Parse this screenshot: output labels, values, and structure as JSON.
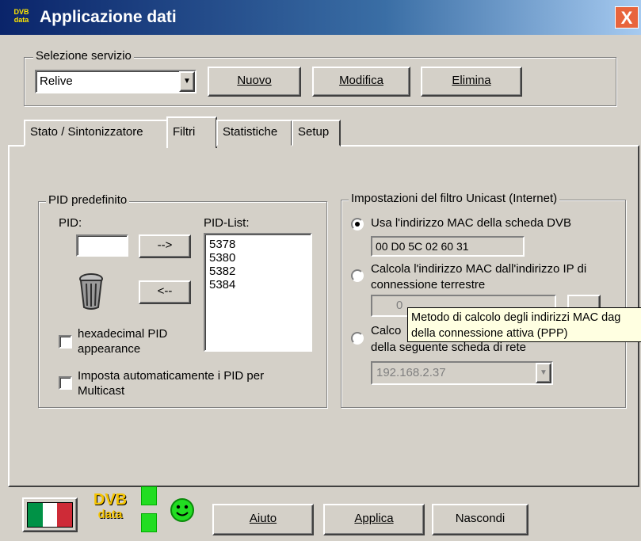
{
  "window": {
    "title": "Applicazione dati",
    "app_icon_text": "DVB data",
    "close_glyph": "X"
  },
  "service": {
    "group_label": "Selezione servizio",
    "selected": "Relive",
    "new_label": "Nuovo",
    "edit_label": "Modifica",
    "delete_label": "Elimina"
  },
  "tabs": [
    {
      "label": "Stato / Sintonizzatore",
      "active": false
    },
    {
      "label": "Filtri",
      "active": true
    },
    {
      "label": "Statistiche",
      "active": false
    },
    {
      "label": "Setup",
      "active": false
    }
  ],
  "pid": {
    "group_label": "PID predefinito",
    "pid_label": "PID:",
    "list_label": "PID-List:",
    "add_label": "-->",
    "remove_label": "<--",
    "list": [
      "5378",
      "5380",
      "5382",
      "5384"
    ],
    "hex_label": "hexadecimal PID appearance",
    "auto_label": "Imposta automaticamente i PID per Multicast"
  },
  "unicast": {
    "group_label": "Impostazioni del filtro Unicast (Internet)",
    "option1_label": "Usa l'indirizzo MAC della scheda DVB",
    "mac_value": "00 D0 5C 02 60 31",
    "option2_label": "Calcola l'indirizzo MAC dall'indirizzo IP di connessione terrestre",
    "ip_first_octet": "0",
    "option3_label": "Calco",
    "option3_label_line2": "della seguente scheda di rete",
    "network_ip": "192.168.2.37"
  },
  "tooltip": {
    "line1": "Metodo di calcolo degli indirizzi MAC dag",
    "line2": "della connessione attiva (PPP)"
  },
  "footer": {
    "logo_text_top": "DVB",
    "logo_text_bottom": "data",
    "help_label": "Aiuto",
    "apply_label": "Applica",
    "hide_label": "Nascondi"
  },
  "colors": {
    "title_start": "#0a246a",
    "title_end": "#a6caf0",
    "led": "#22dd22",
    "smiley": "#22dd22",
    "tooltip_bg": "#ffffe1"
  }
}
